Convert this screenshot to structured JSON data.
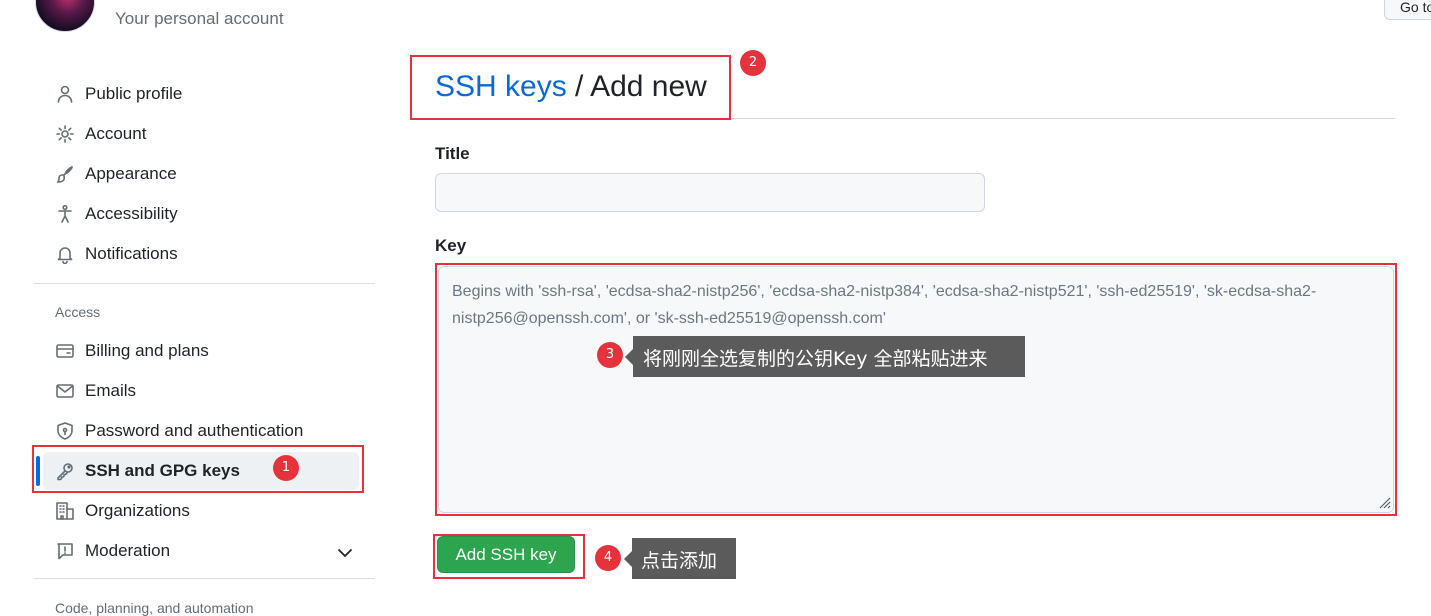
{
  "header": {
    "account_subtitle": "Your personal account",
    "goto_button_label": "Go to"
  },
  "sidebar": {
    "items": [
      {
        "label": "Public profile",
        "icon": "person-icon"
      },
      {
        "label": "Account",
        "icon": "gear-icon"
      },
      {
        "label": "Appearance",
        "icon": "paintbrush-icon"
      },
      {
        "label": "Accessibility",
        "icon": "accessibility-icon"
      },
      {
        "label": "Notifications",
        "icon": "bell-icon"
      }
    ],
    "access_label": "Access",
    "access_items": [
      {
        "label": "Billing and plans",
        "icon": "credit-card-icon"
      },
      {
        "label": "Emails",
        "icon": "mail-icon"
      },
      {
        "label": "Password and authentication",
        "icon": "shield-lock-icon"
      },
      {
        "label": "SSH and GPG keys",
        "icon": "key-icon",
        "active": true
      },
      {
        "label": "Organizations",
        "icon": "organization-icon"
      },
      {
        "label": "Moderation",
        "icon": "report-icon"
      }
    ],
    "next_section_label": "Code, planning, and automation"
  },
  "main": {
    "breadcrumb_link": "SSH keys",
    "breadcrumb_separator": " / ",
    "breadcrumb_current": "Add new",
    "title_label": "Title",
    "title_value": "",
    "key_label": "Key",
    "key_placeholder": "Begins with 'ssh-rsa', 'ecdsa-sha2-nistp256', 'ecdsa-sha2-nistp384', 'ecdsa-sha2-nistp521', 'ssh-ed25519', 'sk-ecdsa-sha2-nistp256@openssh.com', or 'sk-ssh-ed25519@openssh.com'",
    "submit_label": "Add SSH key"
  },
  "annotations": {
    "badges": [
      "1",
      "2",
      "3",
      "4"
    ],
    "tooltip_paste": "将刚刚全选复制的公钥Key  全部粘贴进来",
    "tooltip_add": "点击添加"
  },
  "colors": {
    "accent": "#0969da",
    "primary_button": "#2da44e",
    "annotation_red": "#e5323b",
    "tooltip_bg": "#5b5b5b"
  }
}
